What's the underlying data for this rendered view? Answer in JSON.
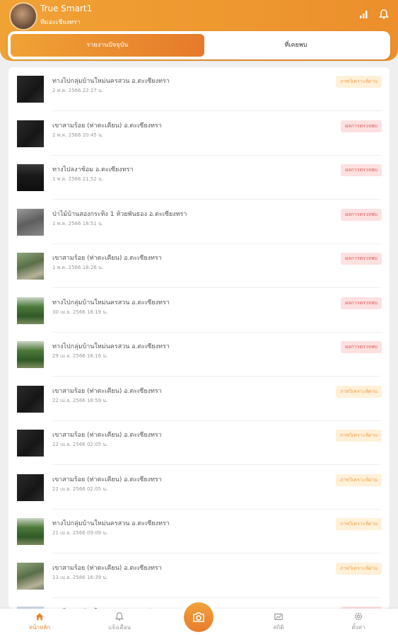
{
  "header": {
    "title": "True Smart1",
    "subtitle": "ทีมอะเชียงทรา",
    "signal_icon": "signal-icon",
    "bell_icon": "bell-icon"
  },
  "tabs": [
    {
      "label": "รายงานปัจจุบัน",
      "active": true
    },
    {
      "label": "ที่เคยพบ",
      "active": false
    }
  ],
  "items": [
    {
      "title": "ทางไปกลุ่มบ้านใหม่นครสวน อ.ตะเซียงทรา",
      "date": "2 พ.ค. 2566 22:27 น.",
      "badge": "ภาพวิเคราะห์ผ่าน",
      "status": "orange",
      "thumb": "night"
    },
    {
      "title": "เขาสามร้อย (ท่าตะเคียน) อ.ตะเซียงทรา",
      "date": "2 พ.ค. 2566 20:45 น.",
      "badge": "ผลการตรวจพบ",
      "status": "red",
      "thumb": "night"
    },
    {
      "title": "ทางไปลงาช้อม อ.ตะเซียงทรา",
      "date": "1 พ.ค. 2566 21:52 น.",
      "badge": "ผลการตรวจพบ",
      "status": "red",
      "thumb": "night2"
    },
    {
      "title": "ป่าไม้บ้านสองกระทิง 1 ห้วยพันธอง อ.ตะเซียงทรา",
      "date": "1 พ.ค. 2566 18:51 น.",
      "badge": "ผลการตรวจพบ",
      "status": "red",
      "thumb": "gray"
    },
    {
      "title": "เขาสามร้อย (ท่าตะเคียน) อ.ตะเซียงทรา",
      "date": "1 พ.ค. 2566 18:26 น.",
      "badge": "ผลการตรวจพบ",
      "status": "red",
      "thumb": "day"
    },
    {
      "title": "ทางไปกลุ่มบ้านใหม่นครสวน อ.ตะเซียงทรา",
      "date": "30 เม.ย. 2566 18:19 น.",
      "badge": "ผลการตรวจพบ",
      "status": "red",
      "thumb": "green"
    },
    {
      "title": "ทางไปกลุ่มบ้านใหม่นครสวน อ.ตะเซียงทรา",
      "date": "29 เม.ย. 2566 16:16 น.",
      "badge": "ผลการตรวจพบ",
      "status": "red",
      "thumb": "green"
    },
    {
      "title": "เขาสามร้อย (ท่าตะเคียน) อ.ตะเซียงทรา",
      "date": "22 เม.ย. 2566 18:59 น.",
      "badge": "ภาพวิเคราะห์ผ่าน",
      "status": "orange",
      "thumb": "night"
    },
    {
      "title": "เขาสามร้อย (ท่าตะเคียน) อ.ตะเซียงทรา",
      "date": "22 เม.ย. 2566 02:05 น.",
      "badge": "ภาพวิเคราะห์ผ่าน",
      "status": "orange",
      "thumb": "night"
    },
    {
      "title": "เขาสามร้อย (ท่าตะเคียน) อ.ตะเซียงทรา",
      "date": "22 เม.ย. 2566 02:05 น.",
      "badge": "ภาพวิเคราะห์ผ่าน",
      "status": "orange",
      "thumb": "night"
    },
    {
      "title": "ทางไปกลุ่มบ้านใหม่นครสวน อ.ตะเซียงทรา",
      "date": "21 เม.ย. 2566 09:09 น.",
      "badge": "ภาพวิเคราะห์ผ่าน",
      "status": "orange",
      "thumb": "green"
    },
    {
      "title": "เขาสามร้อย (ท่าตะเคียน) อ.ตะเซียงทรา",
      "date": "13 เม.ย. 2566 16:39 น.",
      "badge": "ภาพวิเคราะห์ผ่าน",
      "status": "orange",
      "thumb": "day"
    },
    {
      "title": "ทางไปกลุ่มบ้านใหม่นครสวน อ.ตะเซียงทรา",
      "date": "",
      "badge": "ผลการตรวจพบ",
      "status": "red",
      "thumb": "blue"
    }
  ],
  "bottom_nav": [
    {
      "label": "หน้าหลัก",
      "icon": "home-icon",
      "active": true
    },
    {
      "label": "แจ้งเตือน",
      "icon": "bell-icon",
      "active": false
    },
    {
      "label": "สถิติ",
      "icon": "stats-icon",
      "active": false
    },
    {
      "label": "ตั้งค่า",
      "icon": "settings-icon",
      "active": false
    }
  ],
  "fab_icon": "camera-icon",
  "colors": {
    "accent": "#ec8f2c",
    "badge_red": "#fde0e0",
    "badge_orange": "#fff0d8"
  }
}
